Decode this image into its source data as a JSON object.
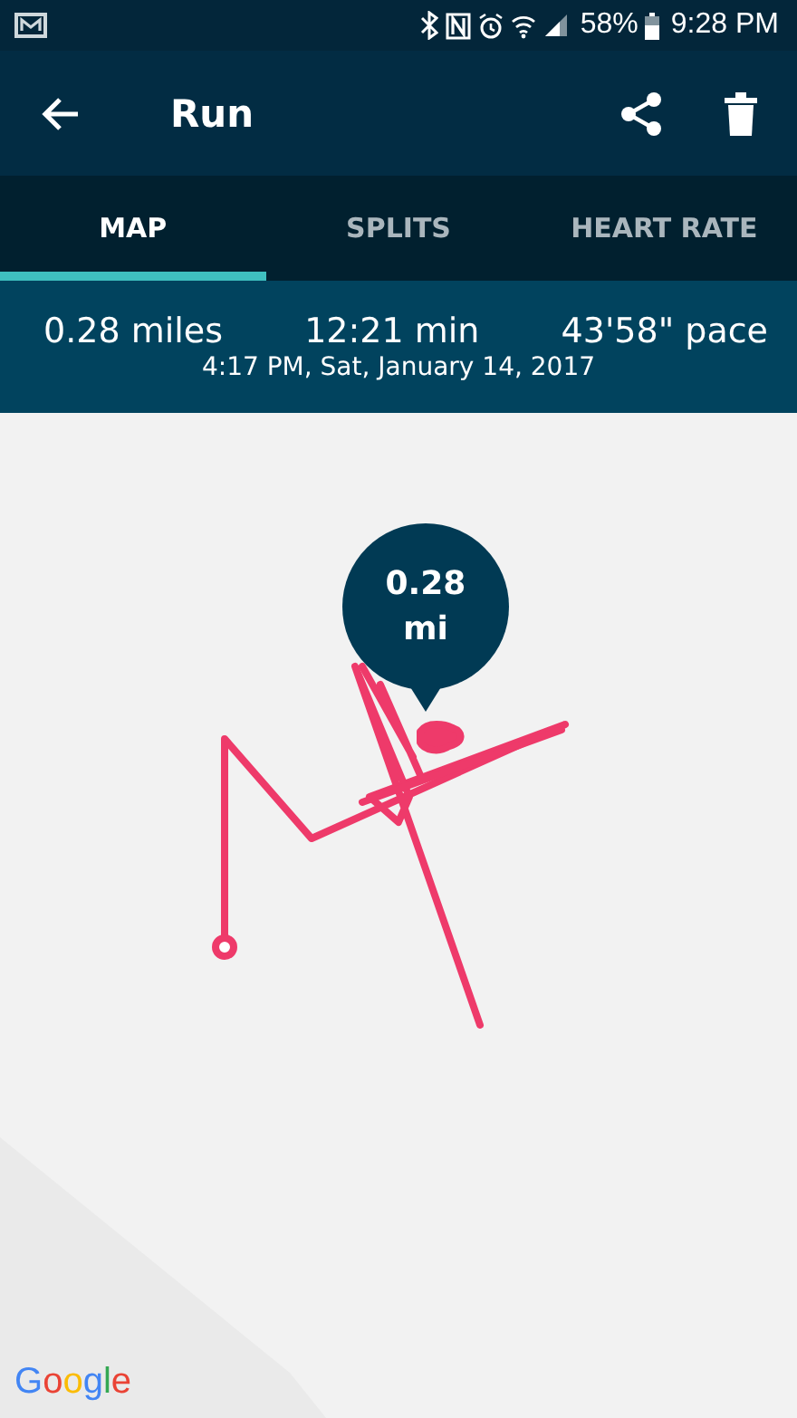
{
  "status_bar": {
    "battery": "58%",
    "time": "9:28 PM"
  },
  "toolbar": {
    "title": "Run"
  },
  "tabs": [
    {
      "label": "MAP",
      "selected": true
    },
    {
      "label": "SPLITS",
      "selected": false
    },
    {
      "label": "HEART RATE",
      "selected": false
    }
  ],
  "summary": {
    "distance": "0.28 miles",
    "duration": "12:21 min",
    "pace": "43'58\" pace",
    "date": "4:17 PM, Sat, January 14, 2017"
  },
  "map": {
    "marker": {
      "value": "0.28",
      "unit": "mi"
    },
    "attribution": "Google"
  }
}
